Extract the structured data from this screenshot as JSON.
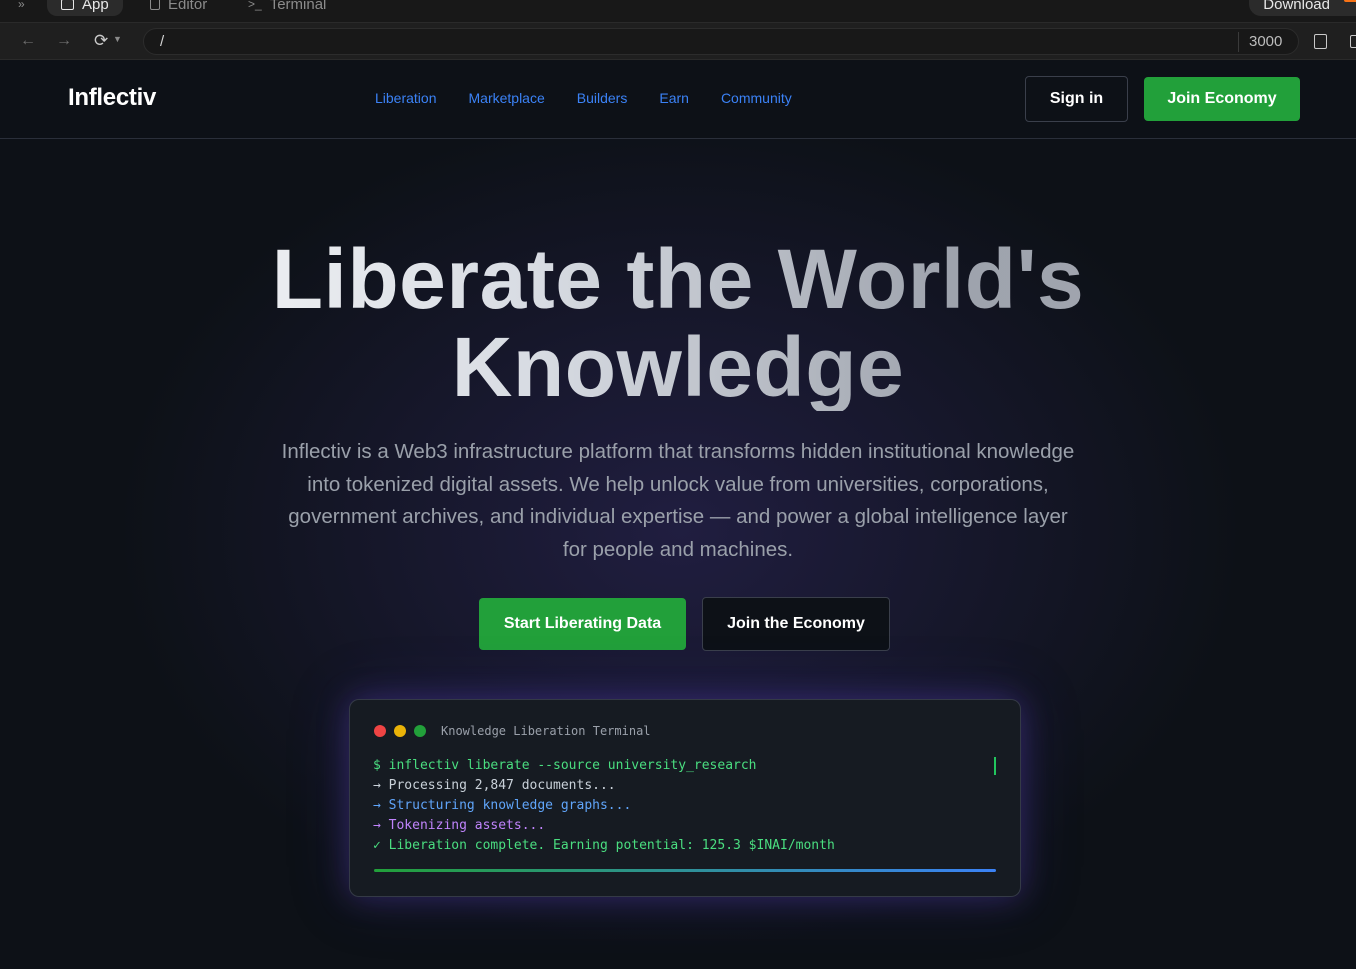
{
  "ide": {
    "tabs": [
      {
        "label": "App",
        "active": true
      },
      {
        "label": "Editor",
        "active": false
      },
      {
        "label": "Terminal",
        "active": false
      }
    ],
    "download_label": "Download",
    "url": "/",
    "port": "3000"
  },
  "nav": {
    "logo": "Inflectiv",
    "links": [
      "Liberation",
      "Marketplace",
      "Builders",
      "Earn",
      "Community"
    ],
    "signin_label": "Sign in",
    "join_label": "Join Economy"
  },
  "hero": {
    "title_line1": "Liberate the World's",
    "title_line2": "Knowledge",
    "subtitle": "Inflectiv is a Web3 infrastructure platform that transforms hidden institutional knowledge into tokenized digital assets. We help unlock value from universities, corporations, government archives, and individual expertise — and power a global intelligence layer for people and machines.",
    "cta_primary": "Start Liberating Data",
    "cta_secondary": "Join the Economy"
  },
  "terminal": {
    "title": "Knowledge Liberation Terminal",
    "lines": [
      "$ inflectiv liberate --source university_research",
      "→ Processing 2,847 documents...",
      "→ Structuring knowledge graphs...",
      "→ Tokenizing assets...",
      "✓ Liberation complete. Earning potential: 125.3 $INAI/month"
    ],
    "progress": 1.0
  },
  "colors": {
    "accent_green": "#22a03a",
    "link_blue": "#3b82f6",
    "background": "#0d1117"
  }
}
